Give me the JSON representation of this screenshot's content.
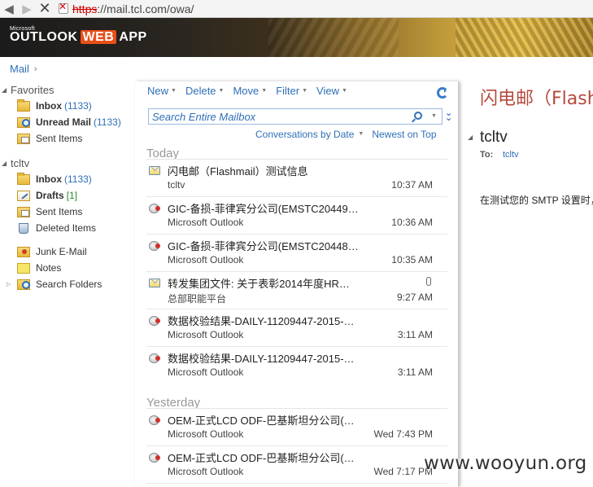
{
  "browser": {
    "url_scheme": "https",
    "url_rest": "://mail.tcl.com/owa/"
  },
  "app": {
    "logo_ms": "Microsoft",
    "logo_outlook": "OUTLOOK",
    "logo_web": "WEB",
    "logo_app": "APP",
    "accent_color": "#2e6fb7"
  },
  "breadcrumb": {
    "label": "Mail",
    "sep": "›"
  },
  "sidebar": {
    "favorites": {
      "label": "Favorites",
      "items": [
        {
          "name": "Inbox",
          "count": "(1133)"
        },
        {
          "name": "Unread Mail",
          "count": "(1133)"
        },
        {
          "name": "Sent Items",
          "count": ""
        }
      ]
    },
    "account": {
      "label": "tcltv",
      "items": [
        {
          "name": "Inbox",
          "count": "(1133)"
        },
        {
          "name": "Drafts",
          "count": "[1]"
        },
        {
          "name": "Sent Items",
          "count": ""
        },
        {
          "name": "Deleted Items",
          "count": ""
        },
        {
          "name": "Junk E-Mail",
          "count": ""
        },
        {
          "name": "Notes",
          "count": ""
        },
        {
          "name": "Search Folders",
          "count": ""
        }
      ]
    }
  },
  "toolbar": {
    "new": "New",
    "delete": "Delete",
    "move": "Move",
    "filter": "Filter",
    "view": "View"
  },
  "search": {
    "placeholder": "Search Entire Mailbox"
  },
  "sort": {
    "by": "Conversations by Date",
    "order": "Newest on Top"
  },
  "groups": {
    "today": "Today",
    "yesterday": "Yesterday"
  },
  "mails": [
    {
      "icon": "envelope-icon",
      "subject": "闪电邮（Flashmail）测试信息",
      "from": "tcltv",
      "time": "10:37 AM",
      "attachment": false
    },
    {
      "icon": "outlook-icon",
      "subject": "GIC-备损-菲律宾分公司(EMSTC20449…",
      "from": "Microsoft Outlook",
      "time": "10:36 AM",
      "attachment": false
    },
    {
      "icon": "outlook-icon",
      "subject": "GIC-备损-菲律宾分公司(EMSTC20448…",
      "from": "Microsoft Outlook",
      "time": "10:35 AM",
      "attachment": false
    },
    {
      "icon": "envelope-icon",
      "subject": "转发集团文件: 关于表彰2014年度HR…",
      "from": "总部职能平台",
      "time": "9:27 AM",
      "attachment": true
    },
    {
      "icon": "outlook-icon",
      "subject": "数据校验结果-DAILY-11209447-2015-…",
      "from": "Microsoft Outlook",
      "time": "3:11 AM",
      "attachment": false
    },
    {
      "icon": "outlook-icon",
      "subject": "数据校验结果-DAILY-11209447-2015-…",
      "from": "Microsoft Outlook",
      "time": "3:11 AM",
      "attachment": false
    },
    {
      "icon": "outlook-icon",
      "subject": "OEM-正式LCD ODF-巴基斯坦分公司(…",
      "from": "Microsoft Outlook",
      "time": "Wed 7:43 PM",
      "attachment": false
    },
    {
      "icon": "outlook-icon",
      "subject": "OEM-正式LCD ODF-巴基斯坦分公司(…",
      "from": "Microsoft Outlook",
      "time": "Wed 7:17 PM",
      "attachment": false
    }
  ],
  "reading": {
    "title": "闪电邮（Flashmail）测试信息",
    "sender": "tcltv",
    "to_label": "To:",
    "to": "tcltv",
    "body": "在测试您的 SMTP 设置时，闪电邮自动发送的电子邮件。"
  },
  "watermark": "www.wooyun.org"
}
